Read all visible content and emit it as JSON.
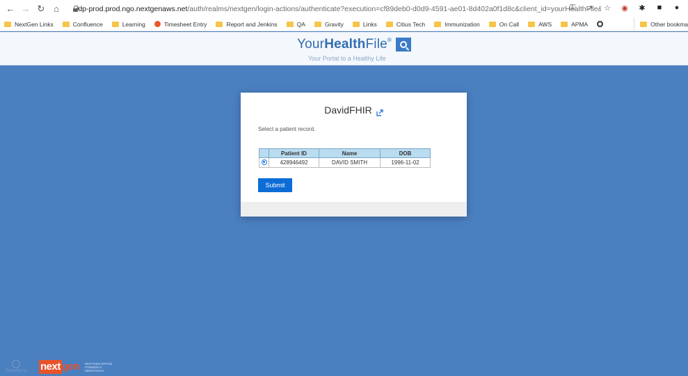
{
  "browser": {
    "url_host": "idp-prod.prod.ngo.nextgenaws.net",
    "url_path": "/auth/realms/nextgen/login-actions/authenticate?execution=cf89deb0-d0d9-4591-ae01-8d402a0f1d8c&client_id=yourHealthFile&tab_id=c..."
  },
  "bookmarks": {
    "items": [
      {
        "label": "NextGen Links",
        "icon": "folder-icon"
      },
      {
        "label": "Confluence",
        "icon": "folder-icon"
      },
      {
        "label": "Learning",
        "icon": "folder-icon"
      },
      {
        "label": "Timesheet Entry",
        "icon": "app-icon"
      },
      {
        "label": "Report and Jenkins",
        "icon": "folder-icon"
      },
      {
        "label": "QA",
        "icon": "folder-icon"
      },
      {
        "label": "Gravity",
        "icon": "folder-icon"
      },
      {
        "label": "Links",
        "icon": "folder-icon"
      },
      {
        "label": "Citius Tech",
        "icon": "folder-icon"
      },
      {
        "label": "Immunization",
        "icon": "folder-icon"
      },
      {
        "label": "On Call",
        "icon": "folder-icon"
      },
      {
        "label": "AWS",
        "icon": "folder-icon"
      },
      {
        "label": "APMA",
        "icon": "folder-icon"
      }
    ],
    "other": "Other bookma"
  },
  "header": {
    "logo_prefix": "Your",
    "logo_bold": "Health",
    "logo_suffix": "File",
    "logo_reg": "®",
    "tagline": "Your Portal to a Healthy Life"
  },
  "card": {
    "title": "DavidFHIR",
    "instruction": "Select a patient record.",
    "columns": [
      "Patient ID",
      "Name",
      "DOB"
    ],
    "rows": [
      {
        "selected": true,
        "patient_id": "428946492",
        "name": "DAVID SMITH",
        "dob": "1996-11-02"
      }
    ],
    "submit_label": "Submit"
  },
  "footer": {
    "powered": "Powered by",
    "brand_next": "next",
    "brand_gen": "gen",
    "brand_sub": "NEXTGEN OFFICE FORMERLY MEDITOUCH"
  },
  "colors": {
    "page_bg": "#4a7fc0",
    "accent": "#0d6cd6",
    "brand": "#e8532c"
  }
}
